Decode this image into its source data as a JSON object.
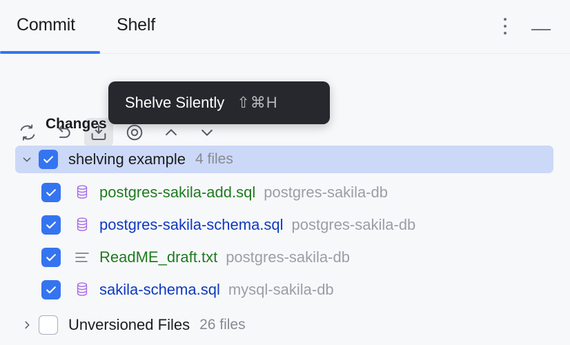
{
  "window": {
    "kebab_icon": "more-vertical-icon",
    "minimize_icon": "minimize-icon"
  },
  "tabs": [
    {
      "label": "Commit",
      "active": true
    },
    {
      "label": "Shelf",
      "active": false
    }
  ],
  "toolbar": {
    "buttons": [
      {
        "name": "refresh-button",
        "icon": "refresh-icon",
        "active": false
      },
      {
        "name": "rollback-button",
        "icon": "rollback-icon",
        "active": false
      },
      {
        "name": "shelve-silently-button",
        "icon": "shelve-icon",
        "active": true
      },
      {
        "name": "show-diff-button",
        "icon": "diff-circle-icon",
        "active": false
      },
      {
        "name": "previous-change-button",
        "icon": "chevron-up-icon",
        "active": false
      },
      {
        "name": "next-change-button",
        "icon": "chevron-down-icon",
        "active": false
      }
    ]
  },
  "tooltip": {
    "text": "Shelve Silently",
    "shortcut": "⇧⌘H",
    "background": "#27282e"
  },
  "changes": {
    "section_label": "Changes",
    "group": {
      "label": "shelving example",
      "count": "4 files",
      "checked": true,
      "expanded": true,
      "selected": true
    },
    "files": [
      {
        "name": "postgres-sakila-add.sql",
        "location": "postgres-sakila-db",
        "checked": true,
        "icon": "database-icon",
        "color": "#1f7a1f"
      },
      {
        "name": "postgres-sakila-schema.sql",
        "location": "postgres-sakila-db",
        "checked": true,
        "icon": "database-icon",
        "color": "#0f39bf"
      },
      {
        "name": "ReadME_draft.txt",
        "location": "postgres-sakila-db",
        "checked": true,
        "icon": "text-file-icon",
        "color": "#1f7a1f"
      },
      {
        "name": "sakila-schema.sql",
        "location": "mysql-sakila-db",
        "checked": true,
        "icon": "database-icon",
        "color": "#0f39bf"
      }
    ]
  },
  "unversioned": {
    "label": "Unversioned Files",
    "count": "26 files",
    "checked": false,
    "expanded": false
  },
  "colors": {
    "accent": "#3574f0",
    "selection": "#ccd8f7",
    "background": "#f7f8fa",
    "added_file": "#1f7a1f",
    "modified_file": "#0f39bf",
    "muted_text": "#9a9ea6"
  }
}
